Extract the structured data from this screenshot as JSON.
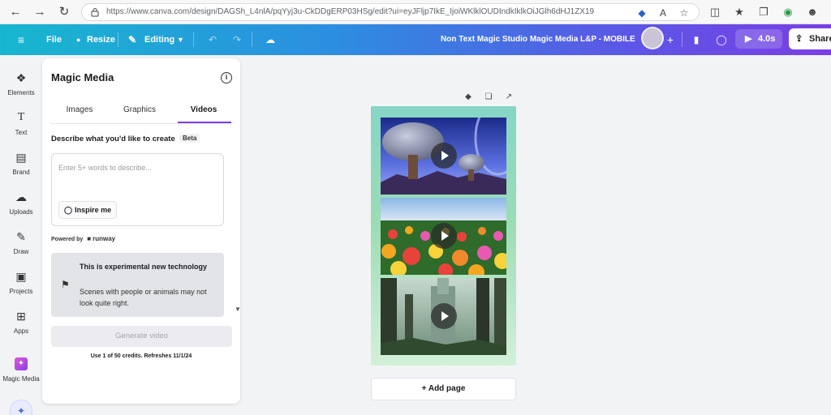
{
  "browser": {
    "url": "https://www.canva.com/design/DAGSh_L4nlA/pqYyj3u-CkDDgERP03HSg/edit?ui=eyJFljp7IkE_IjoiWKlklOUDIndkIklkOiJGlh6dHJ1ZX19",
    "icons": [
      "back-icon",
      "forward-icon",
      "refresh-icon",
      "lock-icon",
      "extension-icon",
      "read-aloud-icon",
      "favorite-icon",
      "split-screen-icon",
      "collections-icon",
      "tab-actions-icon",
      "profile-icon"
    ]
  },
  "header": {
    "menu_icon": "hamburger-icon",
    "file": "File",
    "resize": "Resize",
    "editing": "Editing",
    "doc_title": "Non Text Magic Studio Magic Media L&P - MOBILE",
    "play_time": "4.0s",
    "share": "Share",
    "colors": {
      "gradient_start": "#17b7cf",
      "gradient_end": "#7a3fe4"
    }
  },
  "rail": {
    "items": [
      {
        "label": "Elements",
        "icon": "elements-icon"
      },
      {
        "label": "Text",
        "icon": "text-icon"
      },
      {
        "label": "Brand",
        "icon": "brand-icon"
      },
      {
        "label": "Uploads",
        "icon": "uploads-icon"
      },
      {
        "label": "Draw",
        "icon": "draw-icon"
      },
      {
        "label": "Projects",
        "icon": "projects-icon"
      },
      {
        "label": "Apps",
        "icon": "apps-icon"
      },
      {
        "label": "Magic Media",
        "icon": "magic-media-icon"
      }
    ]
  },
  "panel": {
    "title": "Magic Media",
    "tabs": [
      "Images",
      "Graphics",
      "Videos"
    ],
    "active_tab": "Videos",
    "describe_label": "Describe what you'd like to create",
    "beta": "Beta",
    "prompt_placeholder": "Enter 5+ words to describe...",
    "inspire": "Inspire me",
    "powered_by": "Powered by",
    "powered_brand": "runway",
    "notice_title": "This is experimental new technology",
    "notice_body": "Scenes with people or animals may not look quite right.",
    "generate": "Generate video",
    "credits": "Use 1 of 50 credits. Refreshes 11/1/24"
  },
  "canvas": {
    "add_page": "+ Add page",
    "clips": [
      "alien-landscape-video",
      "flower-field-video",
      "forest-ruins-video"
    ],
    "page_colors": [
      "#86d5c6",
      "#d3f0d9"
    ]
  }
}
